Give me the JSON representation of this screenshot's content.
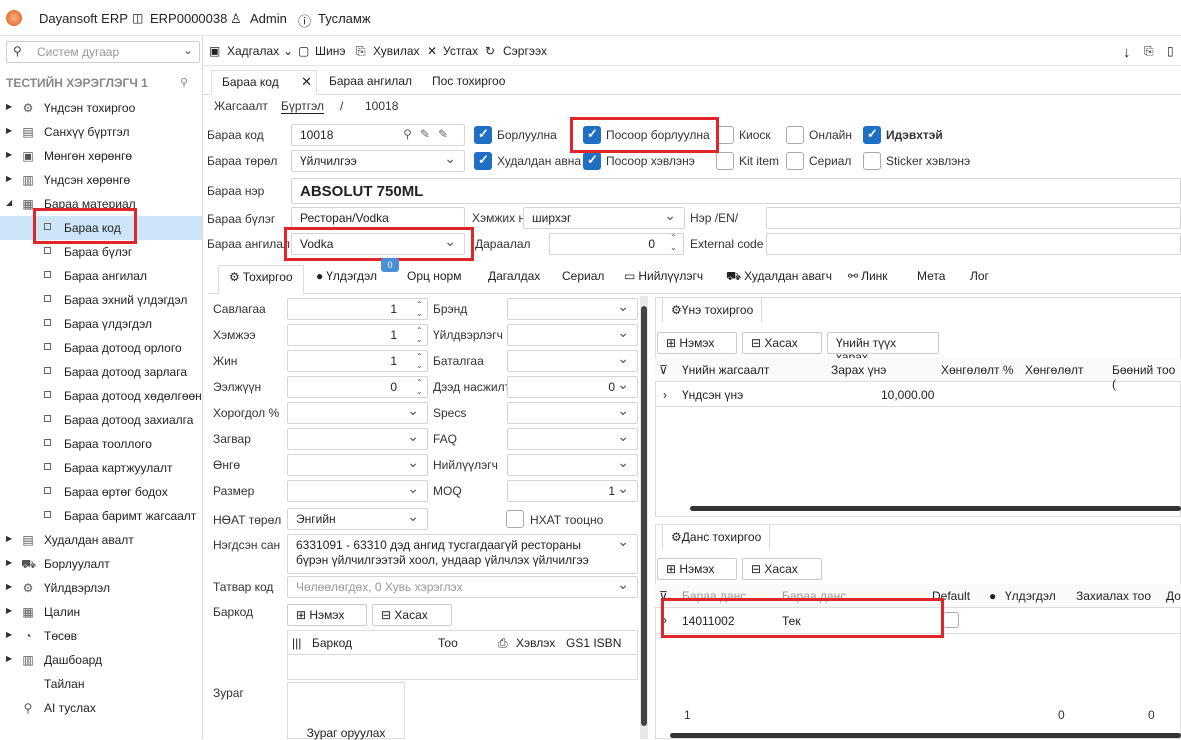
{
  "header": {
    "app": "Dayansoft ERP",
    "doc": "ERP0000038",
    "user": "Admin",
    "help": "Тусламж"
  },
  "sidebar": {
    "search_placeholder": "Систем дугаар",
    "user_title": "ТЕСТИЙН ХЭРЭГЛЭГЧ 1",
    "items": [
      "Үндсэн тохиргоо",
      "Санхүү бүртгэл",
      "Мөнгөн хөрөнгө",
      "Үндсэн хөрөнгө",
      "Бараа материал"
    ],
    "sub": [
      "Бараа код",
      "Бараа бүлэг",
      "Бараа ангилал",
      "Бараа эхний үлдэгдэл",
      "Бараа үлдэгдэл",
      "Бараа дотоод орлого",
      "Бараа дотоод зарлага",
      "Бараа дотоод хөдөлгөөн",
      "Бараа дотоод захиалга",
      "Бараа тооллого",
      "Бараа картжуулалт",
      "Бараа өртөг бодох",
      "Бараа баримт жагсаалт"
    ],
    "items2": [
      "Худалдан авалт",
      "Борлуулалт",
      "Үйлдвэрлэл",
      "Цалин",
      "Төсөв",
      "Дашбоард",
      "Тайлан",
      "AI туслах"
    ]
  },
  "toolbar": {
    "save": "Хадгалах",
    "new": "Шинэ",
    "copy": "Хувилах",
    "delete": "Устгах",
    "refresh": "Сэргээх"
  },
  "tabs": [
    "Бараа код",
    "Бараа ангилал",
    "Пос тохиргоо"
  ],
  "breadcrumb": {
    "list": "Жагсаалт",
    "reg": "Бүртгэл",
    "sep": "/",
    "id": "10018"
  },
  "form": {
    "code_l": "Бараа код",
    "code": "10018",
    "type_l": "Бараа төрөл",
    "type": "Үйлчилгээ",
    "name_l": "Бараа нэр",
    "name": "ABSOLUT 750ML",
    "group_l": "Бараа бүлэг",
    "group": "Ресторан/Vodka",
    "class_l": "Бараа ангилал",
    "class": "Vodka",
    "unit_l": "Хэмжих нэгж",
    "unit": "ширхэг",
    "order_l": "Дараалал",
    "order": "0",
    "en_l": "Нэр /EN/",
    "ext_l": "External code"
  },
  "checks": [
    {
      "l": "Борлуулна",
      "on": true
    },
    {
      "l": "Посоор борлуулна",
      "on": true
    },
    {
      "l": "Киоск",
      "on": false
    },
    {
      "l": "Онлайн",
      "on": false
    },
    {
      "l": "Идэвхтэй",
      "on": true
    },
    {
      "l": "Худалдан авна",
      "on": true
    },
    {
      "l": "Посоор хэвлэнэ",
      "on": true
    },
    {
      "l": "Kit item",
      "on": false
    },
    {
      "l": "Сериал",
      "on": false
    },
    {
      "l": "Sticker хэвлэнэ",
      "on": false
    }
  ],
  "subtabs": [
    "Тохиргоо",
    "Үлдэгдэл",
    "Орц норм",
    "Дагалдах",
    "Сериал",
    "Нийлүүлэгч",
    "Худалдан авагч",
    "Линк",
    "Мета",
    "Лог"
  ],
  "badge": "0",
  "left": {
    "rows": [
      [
        "Савлагаа",
        "1"
      ],
      [
        "Хэмжээ",
        "1"
      ],
      [
        "Жин",
        "1"
      ],
      [
        "Ээлжүүн",
        "0"
      ],
      [
        "Хорогдол %",
        ""
      ],
      [
        "Загвар",
        ""
      ],
      [
        "Өнгө",
        ""
      ],
      [
        "Размер",
        ""
      ]
    ],
    "right": [
      [
        "Брэнд",
        ""
      ],
      [
        "Үйлдвэрлэгч",
        ""
      ],
      [
        "Баталгаа",
        ""
      ],
      [
        "Дээд насжилт",
        "0"
      ],
      [
        "Specs",
        ""
      ],
      [
        "FAQ",
        ""
      ],
      [
        "Нийлүүлэгч",
        ""
      ],
      [
        "MOQ",
        "1"
      ]
    ],
    "vat_l": "НӨАТ төрөл",
    "vat": "Энгийн",
    "nhat": "НХАТ тооцно",
    "nsan_l": "Нэгдсэн сан",
    "nsan": "6331091 - 63310 дэд ангид тусгагдаагүй рестораны бүрэн үйлчилгээтэй хоол, ундаар үйлчлэх үйлчилгээ",
    "tax_l": "Татвар код",
    "tax": "Чөлөөлөгдөх, 0 Хувь хэрэглэх",
    "bar_l": "Баркод",
    "add": "Нэмэх",
    "del": "Хасах",
    "bcols": [
      "Баркод",
      "Тоо",
      "Хэвлэх",
      "GS1 ISBN"
    ],
    "img_l": "Зураг",
    "img": "Зураг оруулах"
  },
  "price": {
    "tab": "Үнэ тохиргоо",
    "add": "Нэмэх",
    "del": "Хасах",
    "hist": "Үнийн түүх харах",
    "cols": [
      "Үнийн жагсаалт",
      "Зарах үнэ",
      "Хөнгөлөлт %",
      "Хөнгөлөлт",
      "Бөөний тоо ("
    ],
    "row": [
      "Үндсэн үнэ",
      "10,000.00"
    ]
  },
  "acct": {
    "tab": "Данс тохиргоо",
    "add": "Нэмэх",
    "del": "Хасах",
    "cols": [
      "Бараа данс",
      "Бараа данс",
      "Default",
      "Үлдэгдэл",
      "Захиалах тоо",
      "До"
    ],
    "row": [
      "14011002",
      "Тек"
    ],
    "foot": [
      "1",
      "0",
      "0"
    ]
  }
}
